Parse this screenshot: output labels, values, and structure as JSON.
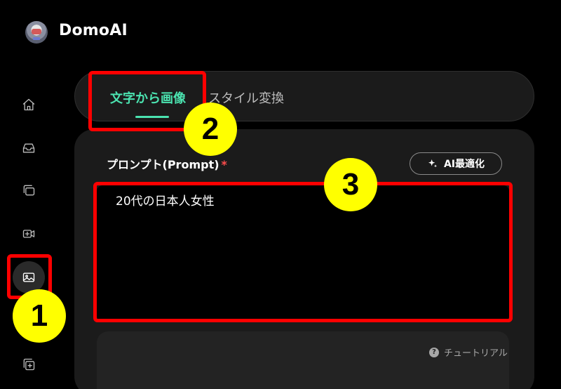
{
  "app": {
    "name": "DomoAI"
  },
  "sidebar": {
    "items": [
      {
        "name": "home",
        "icon": "home-icon"
      },
      {
        "name": "inbox",
        "icon": "inbox-tray-icon"
      },
      {
        "name": "gallery",
        "icon": "stacked-frames-icon"
      },
      {
        "name": "video",
        "icon": "video-add-icon"
      },
      {
        "name": "image",
        "icon": "image-icon",
        "active": true
      },
      {
        "name": "edit",
        "icon": "image-edit-icon"
      }
    ]
  },
  "tabs": {
    "active_label": "文字から画像",
    "inactive_label": "スタイル変換"
  },
  "prompt": {
    "label": "プロンプト(Prompt)",
    "required_mark": "*",
    "optimize_label": "AI最適化",
    "value": "20代の日本人女性"
  },
  "tutorial": {
    "label": "チュートリアル",
    "icon_glyph": "?"
  },
  "annotations": {
    "badge_1": "1",
    "badge_2": "2",
    "badge_3": "3",
    "box_color": "#ff0000",
    "badge_color": "#ffff00"
  },
  "colors": {
    "accent": "#4be3b0",
    "background": "#000000",
    "panel": "#1b1b1b"
  }
}
